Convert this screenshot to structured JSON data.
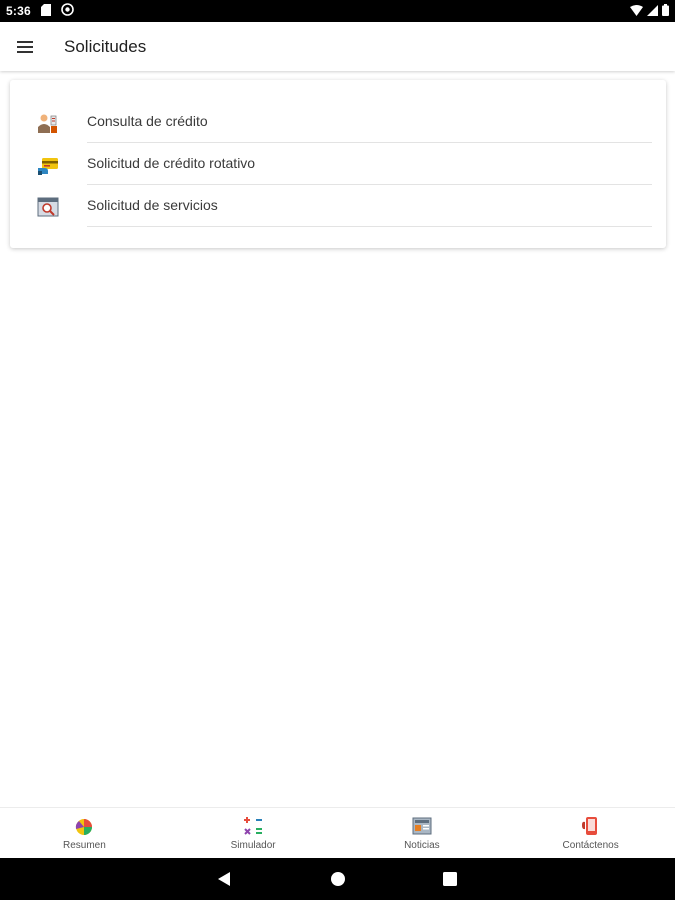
{
  "status_bar": {
    "time": "5:36",
    "left_icons": [
      "sd-card-icon",
      "sync-icon"
    ],
    "right_icons": [
      "wifi-icon",
      "signal-icon",
      "battery-icon"
    ]
  },
  "app_bar": {
    "menu_icon": "menu-icon",
    "title": "Solicitudes"
  },
  "requests": {
    "items": [
      {
        "label": "Consulta de crédito",
        "icon": "credit-query-icon"
      },
      {
        "label": "Solicitud de crédito rotativo",
        "icon": "revolving-credit-icon"
      },
      {
        "label": "Solicitud de servicios",
        "icon": "services-request-icon"
      }
    ]
  },
  "bottom_nav": {
    "items": [
      {
        "label": "Resumen",
        "icon": "summary-chart-icon"
      },
      {
        "label": "Simulador",
        "icon": "calculator-icon"
      },
      {
        "label": "Noticias",
        "icon": "news-icon"
      },
      {
        "label": "Contáctenos",
        "icon": "contact-phone-icon"
      }
    ]
  },
  "system_nav": {
    "buttons": [
      "back-icon",
      "home-icon",
      "recents-icon"
    ]
  },
  "colors": {
    "status_bar_bg": "#000000",
    "app_bar_bg": "#ffffff",
    "text_primary": "#212121",
    "divider": "#e3e3e3"
  }
}
